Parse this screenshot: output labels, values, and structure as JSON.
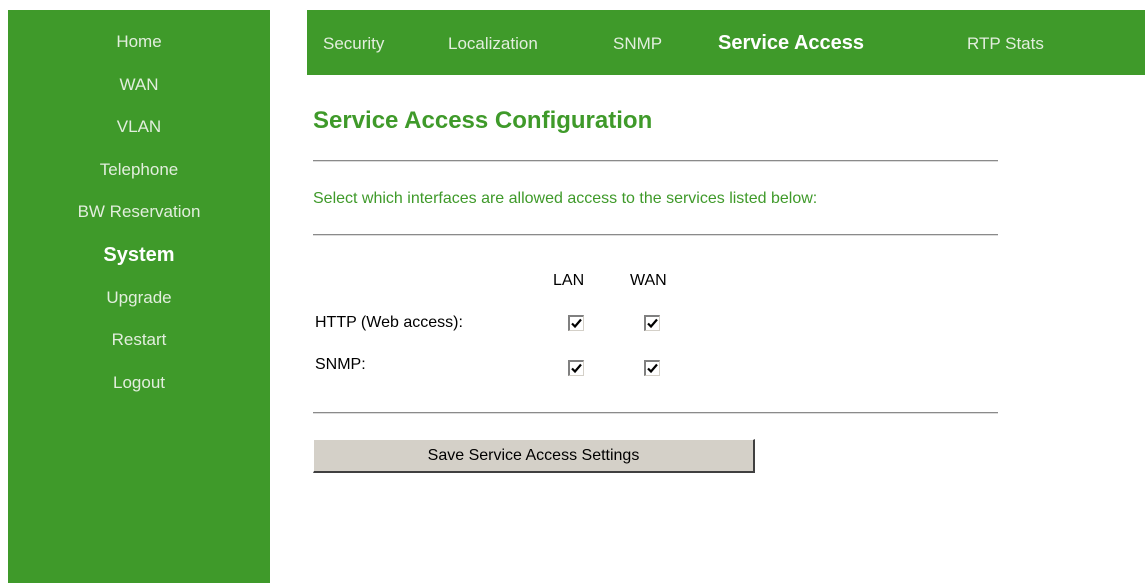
{
  "sidebar": {
    "items": [
      {
        "label": "Home",
        "active": false
      },
      {
        "label": "WAN",
        "active": false
      },
      {
        "label": "VLAN",
        "active": false
      },
      {
        "label": "Telephone",
        "active": false
      },
      {
        "label": "BW Reservation",
        "active": false
      },
      {
        "label": "System",
        "active": true
      },
      {
        "label": "Upgrade",
        "active": false
      },
      {
        "label": "Restart",
        "active": false
      },
      {
        "label": "Logout",
        "active": false
      }
    ]
  },
  "topnav": {
    "tabs": [
      {
        "label": "Security",
        "active": false
      },
      {
        "label": "Localization",
        "active": false
      },
      {
        "label": "SNMP",
        "active": false
      },
      {
        "label": "Service Access",
        "active": true
      },
      {
        "label": "RTP Stats",
        "active": false
      }
    ]
  },
  "main": {
    "title": "Service Access Configuration",
    "instructions": "Select which interfaces are allowed access to the services listed below:",
    "columns": [
      "LAN",
      "WAN"
    ],
    "rows": [
      {
        "label": "HTTP (Web access):",
        "lan": true,
        "wan": true
      },
      {
        "label": "SNMP:",
        "lan": true,
        "wan": true
      }
    ],
    "save_label": "Save Service Access Settings"
  },
  "colors": {
    "brand_green": "#3f9a2a",
    "nav_text": "#e2eedd",
    "button_face": "#d4d0c8"
  }
}
